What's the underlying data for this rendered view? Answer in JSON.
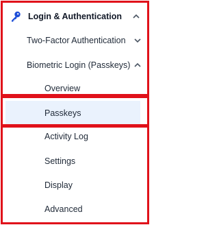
{
  "nav": {
    "section": {
      "label": "Login & Authentication",
      "icon": "key-icon",
      "expanded": true,
      "items": [
        {
          "label": "Two-Factor Authentication",
          "expanded": false
        },
        {
          "label": "Biometric Login (Passkeys)",
          "expanded": true,
          "children": [
            {
              "label": "Overview"
            },
            {
              "label": "Passkeys",
              "selected": true
            }
          ]
        }
      ]
    },
    "more_items": [
      {
        "label": "Activity Log"
      },
      {
        "label": "Settings"
      },
      {
        "label": "Display"
      },
      {
        "label": "Advanced"
      }
    ]
  },
  "colors": {
    "accent": "#1d4ed8",
    "selected_bg": "#eaf2fd",
    "highlight_border": "#e0111a"
  }
}
